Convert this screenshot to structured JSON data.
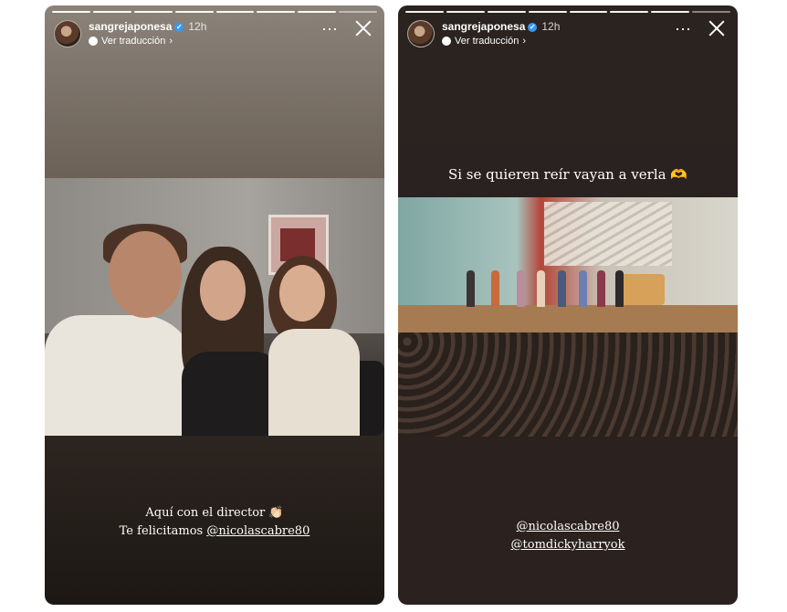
{
  "stories": [
    {
      "username": "sangrejaponesa",
      "time": "12h",
      "translate_label": "Ver traducción",
      "caption_line1": "Aquí con el director 👏🏻",
      "caption_line2_prefix": "Te felicitamos ",
      "caption_mention": "@nicolascabre80"
    },
    {
      "username": "sangrejaponesa",
      "time": "12h",
      "translate_label": "Ver traducción",
      "caption_top": "Si se quieren reír vayan a verla",
      "caption_top_emoji": "🫶",
      "mention1": "@nicolascabre80",
      "mention2": "@tomdickyharryok"
    }
  ],
  "icons": {
    "more": "⋯",
    "verified": "✓",
    "close": "close-icon"
  }
}
